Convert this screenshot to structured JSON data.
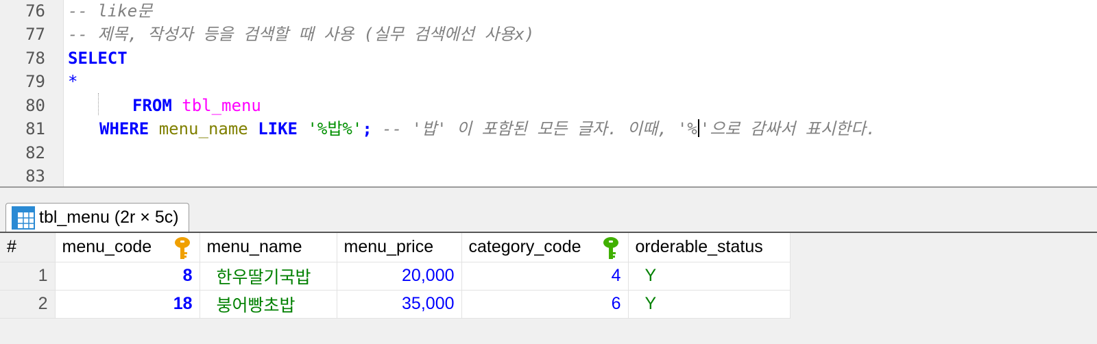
{
  "editor": {
    "line_numbers": [
      "76",
      "77",
      "78",
      "79",
      "80",
      "81",
      "82",
      "83"
    ],
    "lines": {
      "l76": "-- like문",
      "l77": "-- 제목, 작성자 등을 검색할 때 사용 (실무 검색에선 사용x)",
      "l78_kw": "SELECT",
      "l79": "*",
      "l80_kw": "FROM",
      "l80_tbl": "tbl_menu",
      "l81_kw1": "WHERE",
      "l81_col": "menu_name",
      "l81_kw2": "LIKE",
      "l81_str": "'%밥%'",
      "l81_semi": ";",
      "l81_comment_a": "-- '밥' 이 포함된 모든 글자. 이때, '%",
      "l81_comment_b": "'으로 감싸서 표시한다."
    },
    "colors": {
      "keyword": "#0000ff",
      "table": "#ff00ff",
      "column": "#808000",
      "string": "#009000",
      "comment": "#808080"
    }
  },
  "result_tab": {
    "label": "tbl_menu (2r × 5c)",
    "icon": "table-grid-icon"
  },
  "grid": {
    "columns": [
      "#",
      "menu_code",
      "menu_name",
      "menu_price",
      "category_code",
      "orderable_status"
    ],
    "primary_key_icon_color": "#f0a000",
    "foreign_key_icon_color": "#40b000",
    "rows": [
      {
        "num": "1",
        "menu_code": "8",
        "menu_name": "한우딸기국밥",
        "menu_price": "20,000",
        "category_code": "4",
        "orderable_status": "Y"
      },
      {
        "num": "2",
        "menu_code": "18",
        "menu_name": "붕어빵초밥",
        "menu_price": "35,000",
        "category_code": "6",
        "orderable_status": "Y"
      }
    ]
  }
}
